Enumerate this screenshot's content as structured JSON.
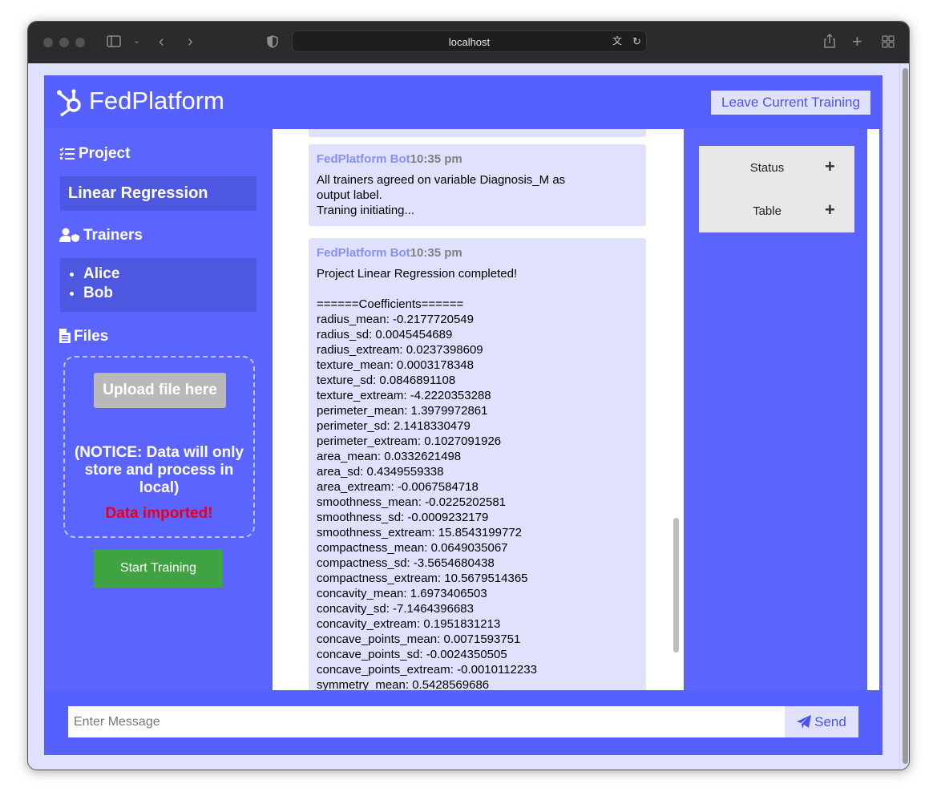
{
  "browser": {
    "url": "localhost"
  },
  "header": {
    "app_name": "FedPlatform",
    "leave_button": "Leave Current Training"
  },
  "sidebar": {
    "project_title": "Project",
    "project_name": "Linear Regression",
    "trainers_title": "Trainers",
    "trainers": [
      "Alice",
      "Bob"
    ],
    "files_title": "Files",
    "upload_button": "Upload file here",
    "notice": "(NOTICE: Data will only store and process in local)",
    "import_status": "Data imported!",
    "start_button": "Start Training"
  },
  "chat": {
    "messages": [
      {
        "author": "FedPlatform Bot",
        "time": "10:35 pm",
        "body": "All trainers agreed on variable Diagnosis_M as\noutput label.\nTraning initiating..."
      },
      {
        "author": "FedPlatform Bot",
        "time": "10:35 pm",
        "body": "Project Linear Regression completed!\n\n======Coefficients======\nradius_mean: -0.2177720549\nradius_sd: 0.0045454689\nradius_extream: 0.0237398609\ntexture_mean: 0.0003178348\ntexture_sd: 0.0846891108\ntexture_extream: -4.2220353288\nperimeter_mean: 1.3979972861\nperimeter_sd: 2.1418330479\nperimeter_extream: 0.1027091926\narea_mean: 0.0332621498\narea_sd: 0.4349559338\narea_extream: -0.0067584718\nsmoothness_mean: -0.0225202581\nsmoothness_sd: -0.0009232179\nsmoothness_extream: 15.8543199772\ncompactness_mean: 0.0649035067\ncompactness_sd: -3.5654680438\ncompactness_extream: 10.5679514365\nconcavity_mean: 1.6973406503\nconcavity_sd: -7.1464396683\nconcavity_extream: 0.1951831213\nconcave_points_mean: 0.0071593751\nconcave_points_sd: -0.0024350505\nconcave_points_extream: -0.0010112233\nsymmetry_mean: 0.5428569686"
      }
    ]
  },
  "right_panel": {
    "items": [
      {
        "label": "Status"
      },
      {
        "label": "Table"
      }
    ]
  },
  "footer": {
    "input_placeholder": "Enter Message",
    "send_button": "Send"
  }
}
